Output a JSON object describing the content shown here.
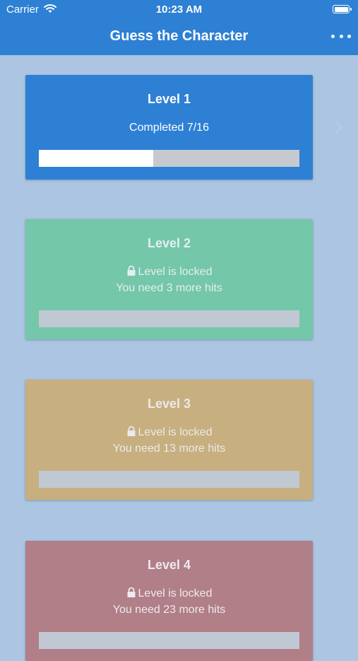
{
  "status_bar": {
    "carrier": "Carrier",
    "time": "10:23 AM",
    "icons": [
      "wifi-icon",
      "battery-icon"
    ]
  },
  "nav": {
    "title": "Guess the Character",
    "menu_icon": "more-horizontal-icon"
  },
  "levels": [
    {
      "name": "Level 1",
      "status": "Completed 7/16",
      "progress": 0.44,
      "color": "#2d80d4",
      "locked": false
    },
    {
      "name": "Level 2",
      "locked_text": "Level is locked",
      "hint": "You need 3 more hits",
      "color": "#74c7a9",
      "locked": true
    },
    {
      "name": "Level 3",
      "locked_text": "Level is locked",
      "hint": "You need 13 more hits",
      "color": "#c8af7f",
      "locked": true
    },
    {
      "name": "Level 4",
      "locked_text": "Level is locked",
      "hint": "You need 23 more hits",
      "color": "#b07f88",
      "locked": true
    }
  ],
  "colors": {
    "background": "#abc5e2",
    "nav_bar": "#2d80d4"
  }
}
